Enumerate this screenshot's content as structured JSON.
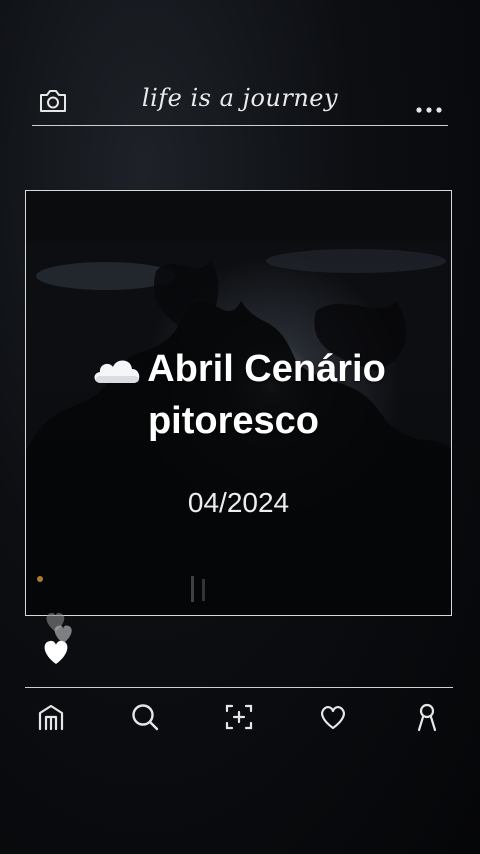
{
  "header": {
    "title": "life is a journey",
    "left_icon": "camera-icon",
    "right_icon": "more-dots-icon"
  },
  "post": {
    "title_line1": "Abril Cenário",
    "title_line2": "pitoresco",
    "title_emoji": "cloud-emoji",
    "date": "04/2024"
  },
  "nav": {
    "items": [
      "home-icon",
      "search-icon",
      "add-post-icon",
      "heart-icon",
      "profile-icon"
    ]
  },
  "colors": {
    "background": "#0c0e12",
    "line": "#cfcfcf",
    "text": "#ffffff"
  }
}
